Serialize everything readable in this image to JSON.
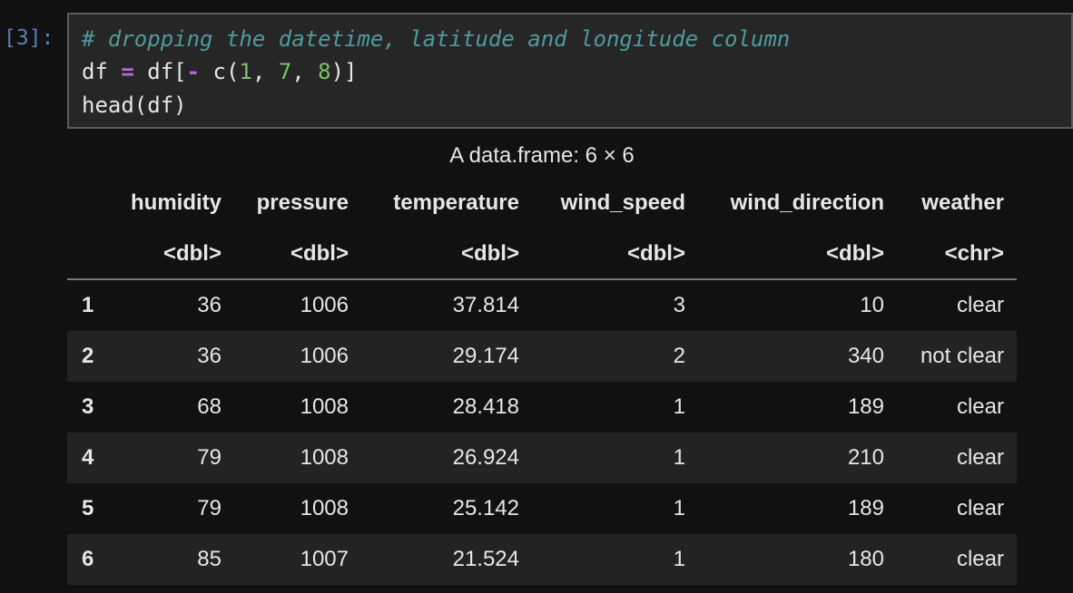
{
  "prompt": "[3]:",
  "code": {
    "line1_comment": "# dropping the datetime, latitude and longitude column",
    "line2": {
      "a": "df ",
      "op1": "=",
      "b": " df[",
      "op2": "-",
      "c": " c(",
      "n1": "1",
      "d": ", ",
      "n2": "7",
      "e": ", ",
      "n3": "8",
      "f": ")]"
    },
    "line3": "head(df)"
  },
  "table": {
    "caption": "A data.frame: 6 × 6",
    "columns": [
      "humidity",
      "pressure",
      "temperature",
      "wind_speed",
      "wind_direction",
      "weather"
    ],
    "types": [
      "<dbl>",
      "<dbl>",
      "<dbl>",
      "<dbl>",
      "<dbl>",
      "<chr>"
    ],
    "rows": [
      {
        "index": "1",
        "values": [
          "36",
          "1006",
          "37.814",
          "3",
          "10",
          "clear"
        ]
      },
      {
        "index": "2",
        "values": [
          "36",
          "1006",
          "29.174",
          "2",
          "340",
          "not clear"
        ]
      },
      {
        "index": "3",
        "values": [
          "68",
          "1008",
          "28.418",
          "1",
          "189",
          "clear"
        ]
      },
      {
        "index": "4",
        "values": [
          "79",
          "1008",
          "26.924",
          "1",
          "210",
          "clear"
        ]
      },
      {
        "index": "5",
        "values": [
          "79",
          "1008",
          "25.142",
          "1",
          "189",
          "clear"
        ]
      },
      {
        "index": "6",
        "values": [
          "85",
          "1007",
          "21.524",
          "1",
          "180",
          "clear"
        ]
      }
    ]
  },
  "colors": {
    "background": "#111111",
    "cell_background": "#262626",
    "comment": "#4f9a9a",
    "operator": "#b66ad9",
    "number": "#7bc26a",
    "prompt": "#5a7fb5",
    "alt_row": "#232323"
  }
}
